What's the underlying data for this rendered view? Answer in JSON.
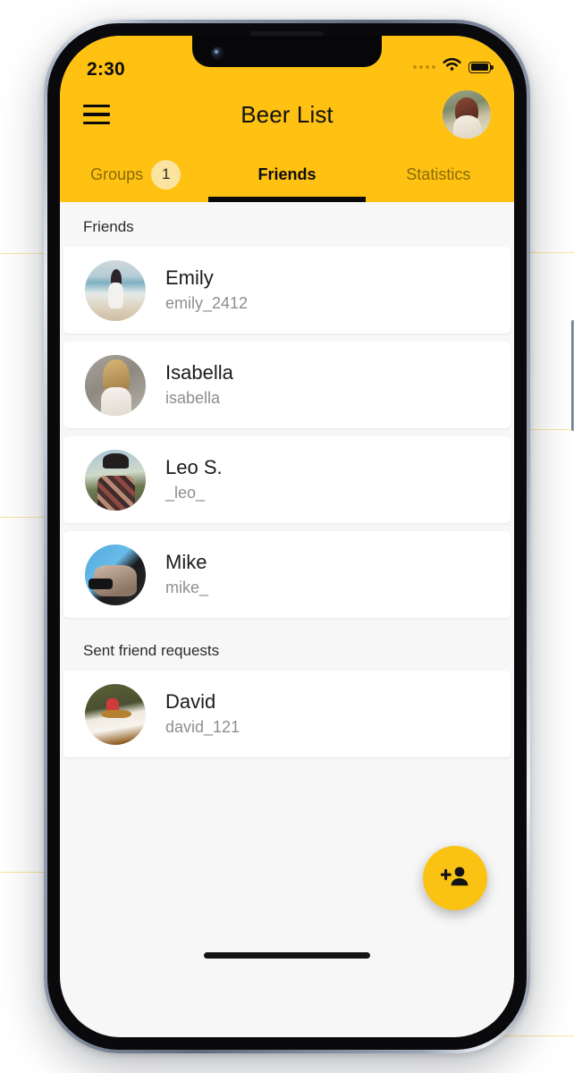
{
  "guides": {
    "color": "#f5d14e"
  },
  "device": {
    "frame_color": "#9aa6b8",
    "screen_bg": "#f7f7f7"
  },
  "status_bar": {
    "time": "2:30",
    "signal_icon": "signal-dots-icon",
    "wifi_icon": "wifi-icon",
    "battery_icon": "battery-full-icon"
  },
  "header": {
    "accent_color": "#FFC212",
    "menu_icon": "hamburger-menu-icon",
    "title": "Beer List",
    "profile_avatar": "user-profile-avatar"
  },
  "tabs": [
    {
      "label": "Groups",
      "badge": "1",
      "active": false
    },
    {
      "label": "Friends",
      "badge": null,
      "active": true
    },
    {
      "label": "Statistics",
      "badge": null,
      "active": false
    }
  ],
  "badge_color": "#FAE4A0",
  "sections": [
    {
      "title": "Friends",
      "items": [
        {
          "name": "Emily",
          "username": "emily_2412",
          "avatar": "emily-avatar"
        },
        {
          "name": "Isabella",
          "username": "isabella",
          "avatar": "isabella-avatar"
        },
        {
          "name": "Leo S.",
          "username": "_leo_",
          "avatar": "leo-avatar"
        },
        {
          "name": "Mike",
          "username": "mike_",
          "avatar": "mike-avatar"
        }
      ]
    },
    {
      "title": "Sent friend requests",
      "items": [
        {
          "name": "David",
          "username": "david_121",
          "avatar": "david-avatar"
        }
      ]
    }
  ],
  "fab": {
    "icon": "person-add-icon",
    "color": "#FAC313"
  },
  "home_indicator": true
}
